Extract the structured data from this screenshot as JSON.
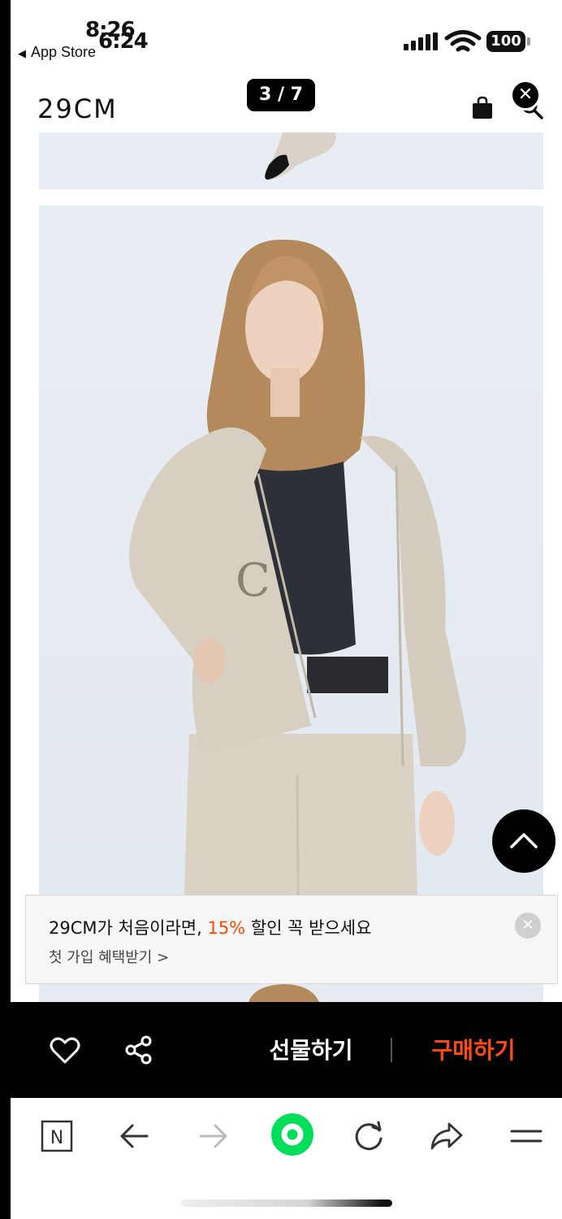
{
  "status_bar": {
    "time_primary": "8:26",
    "time_secondary": "6:24",
    "back_app_label": "App Store",
    "battery_level": "100"
  },
  "header": {
    "logo": "29CM",
    "image_counter": "3 / 7"
  },
  "promo_banner": {
    "title_prefix": "29CM가 처음이라면, ",
    "title_highlight": "15%",
    "title_suffix": " 할인 꼭 받으세요",
    "subtitle": "첫 가입 혜택받기 >"
  },
  "purchase_bar": {
    "gift_label": "선물하기",
    "buy_label": "구매하기",
    "buy_color": "#ff4b12"
  },
  "browser_toolbar": {
    "items": [
      "naver-home-icon",
      "back-arrow-icon",
      "forward-arrow-icon",
      "green-dot-icon",
      "refresh-icon",
      "share-arrow-icon",
      "menu-icon"
    ],
    "accent_color": "#00de5a"
  },
  "colors": {
    "highlight": "#ff4800",
    "bar_background": "#000000"
  }
}
